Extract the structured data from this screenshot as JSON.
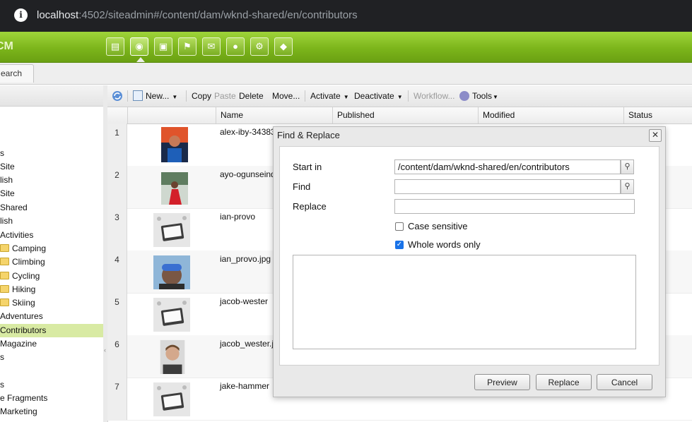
{
  "browser": {
    "host": "localhost",
    "path": ":4502/siteadmin#/content/dam/wknd-shared/en/contributors"
  },
  "app": {
    "logo_text": "CM",
    "nav_icons": [
      "websites-icon",
      "globe-icon",
      "digital-assets-icon",
      "campaigns-icon",
      "inbox-icon",
      "community-icon",
      "tools-icon",
      "tagging-icon"
    ]
  },
  "tabs": {
    "search": "earch"
  },
  "tree": {
    "items": [
      {
        "label": ""
      },
      {
        "label": "s"
      },
      {
        "label": "Site"
      },
      {
        "label": "lish"
      },
      {
        "label": "Site"
      },
      {
        "label": "Shared"
      },
      {
        "label": "lish"
      },
      {
        "label": "Activities"
      },
      {
        "label": "Camping"
      },
      {
        "label": "Climbing"
      },
      {
        "label": "Cycling"
      },
      {
        "label": "Hiking"
      },
      {
        "label": "Skiing"
      },
      {
        "label": "Adventures"
      },
      {
        "label": "Contributors"
      },
      {
        "label": "Magazine"
      },
      {
        "label": "s"
      },
      {
        "label": ""
      },
      {
        "label": "s"
      },
      {
        "label": "e Fragments"
      },
      {
        "label": "Marketing"
      }
    ]
  },
  "toolbar": {
    "new": "New...",
    "copy": "Copy",
    "paste": "Paste",
    "delete": "Delete",
    "move": "Move...",
    "activate": "Activate",
    "deactivate": "Deactivate",
    "workflow": "Workflow...",
    "tools": "Tools"
  },
  "grid": {
    "columns": {
      "name": "Name",
      "published": "Published",
      "modified": "Modified",
      "status": "Status"
    },
    "rows": [
      {
        "num": "1",
        "name": "alex-iby-34383",
        "thumb": "red-portrait"
      },
      {
        "num": "2",
        "name": "ayo-ogunseinde",
        "thumb": "woman-red-dress"
      },
      {
        "num": "3",
        "name": "ian-provo",
        "thumb": "tablet-placeholder"
      },
      {
        "num": "4",
        "name": "ian_provo.jpg",
        "thumb": "skier-goggles"
      },
      {
        "num": "5",
        "name": "jacob-wester",
        "thumb": "tablet-placeholder"
      },
      {
        "num": "6",
        "name": "jacob_wester.j",
        "thumb": "man-portrait"
      },
      {
        "num": "7",
        "name": "jake-hammer",
        "thumb": "tablet-placeholder"
      }
    ]
  },
  "dialog": {
    "title": "Find & Replace",
    "start_in_label": "Start in",
    "start_in_value": "/content/dam/wknd-shared/en/contributors",
    "find_label": "Find",
    "find_value": "",
    "replace_label": "Replace",
    "replace_value": "",
    "case_sensitive_label": "Case sensitive",
    "case_sensitive_checked": false,
    "whole_words_label": "Whole words only",
    "whole_words_checked": true,
    "preview_button": "Preview",
    "replace_button": "Replace",
    "cancel_button": "Cancel"
  }
}
